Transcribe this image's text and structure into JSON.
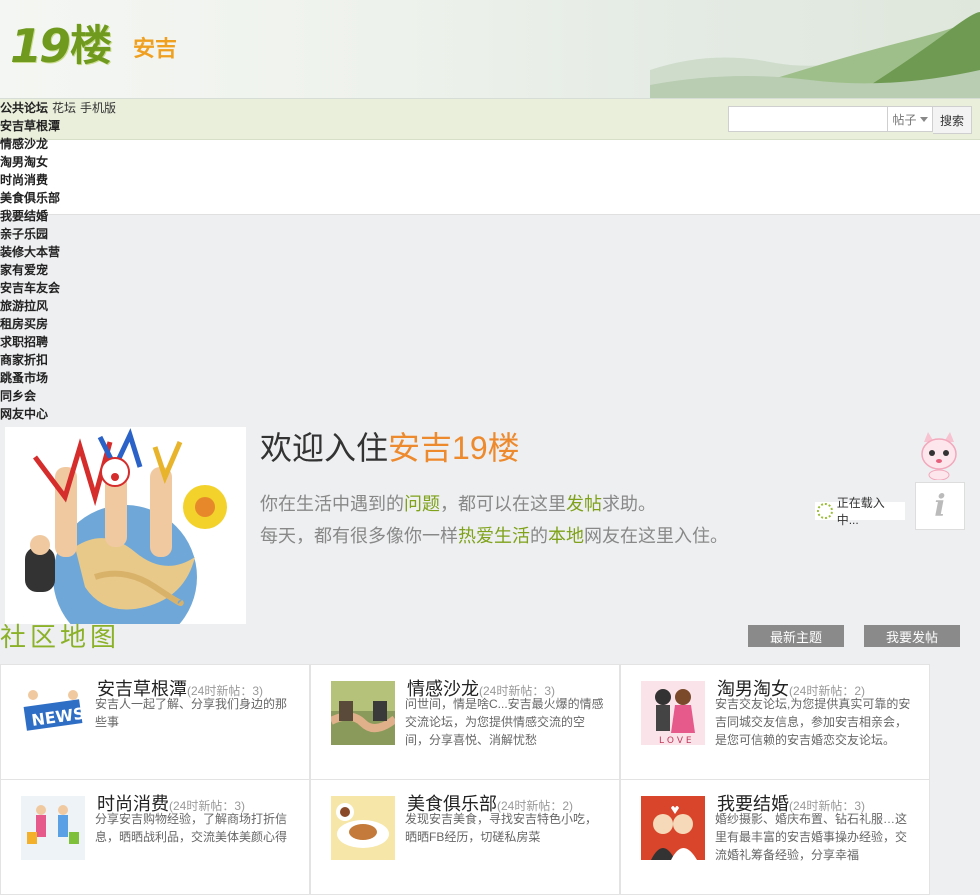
{
  "site": {
    "logo_num": "19",
    "logo_lou": "楼",
    "city": "安吉"
  },
  "top_links": {
    "forum": "公共论坛",
    "huatan": "花坛",
    "mobile": "手机版"
  },
  "search": {
    "placeholder": "",
    "type": "帖子",
    "button": "搜索"
  },
  "menu": [
    "安吉草根潭",
    "情感沙龙",
    "淘男淘女",
    "时尚消费",
    "美食俱乐部",
    "我要结婚",
    "亲子乐园",
    "装修大本营",
    "家有爱宠",
    "安吉车友会",
    "旅游拉风",
    "租房买房",
    "求职招聘",
    "商家折扣",
    "跳蚤市场",
    "同乡会",
    "网友中心"
  ],
  "welcome": {
    "title_a": "欢迎入住",
    "title_b": "安吉19楼",
    "l1_a": "你在生活中遇到的",
    "l1_b": "问题",
    "l1_c": "，都可以在这里",
    "l1_d": "发帖",
    "l1_e": "求助。",
    "l2_a": "每天，都有很多像你一样",
    "l2_b": "热爱生活",
    "l2_c": "的",
    "l2_d": "本地",
    "l2_e": "网友在这里入住。"
  },
  "loading": "正在载入中...",
  "info_icon": "i",
  "map": {
    "title": "社区地图",
    "latest": "最新主题",
    "post": "我要发帖"
  },
  "forums": [
    {
      "title": "安吉草根潭",
      "count": "(24时新帖：3)",
      "desc": "安吉人一起了解、分享我们身边的那些事"
    },
    {
      "title": "情感沙龙",
      "count": "(24时新帖：3)",
      "desc": "问世间，情是啥C...安吉最火爆的情感交流论坛，为您提供情感交流的空间，分享喜悦、消解忧愁"
    },
    {
      "title": "淘男淘女",
      "count": "(24时新帖：2)",
      "desc": "安吉交友论坛,为您提供真实可靠的安吉同城交友信息，参加安吉相亲会，是您可信赖的安吉婚恋交友论坛。"
    },
    {
      "title": "时尚消费",
      "count": "(24时新帖：3)",
      "desc": "分享安吉购物经验，了解商场打折信息，晒晒战利品，交流美体美颜心得"
    },
    {
      "title": "美食俱乐部",
      "count": "(24时新帖：2)",
      "desc": "发现安吉美食，寻找安吉特色小吃，晒晒FB经历，切磋私房菜"
    },
    {
      "title": "我要结婚",
      "count": "(24时新帖：3)",
      "desc": "婚纱摄影、婚庆布置、钻石礼服…这里有最丰富的安吉婚事操办经验，交流婚礼筹备经验，分享幸福"
    }
  ],
  "colors": {
    "accent_green": "#7fa21a",
    "accent_orange": "#ee8a2e",
    "nav_bg": "#e9efdb"
  }
}
